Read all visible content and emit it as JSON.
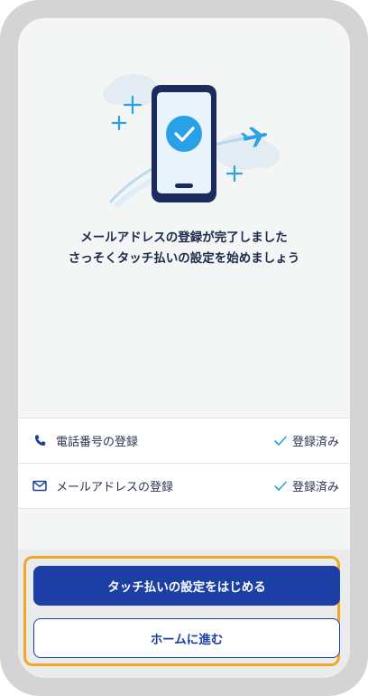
{
  "message": {
    "line1": "メールアドレスの登録が完了しました",
    "line2": "さっそくタッチ払いの設定を始めましょう"
  },
  "registration_items": [
    {
      "icon": "phone-icon",
      "label": "電話番号の登録",
      "status": "登録済み"
    },
    {
      "icon": "mail-icon",
      "label": "メールアドレスの登録",
      "status": "登録済み"
    }
  ],
  "buttons": {
    "primary_label": "タッチ払いの設定をはじめる",
    "secondary_label": "ホームに進む"
  },
  "colors": {
    "primary": "#1c3fa6",
    "accent": "#2aa0e6",
    "highlight": "#f5a623"
  }
}
